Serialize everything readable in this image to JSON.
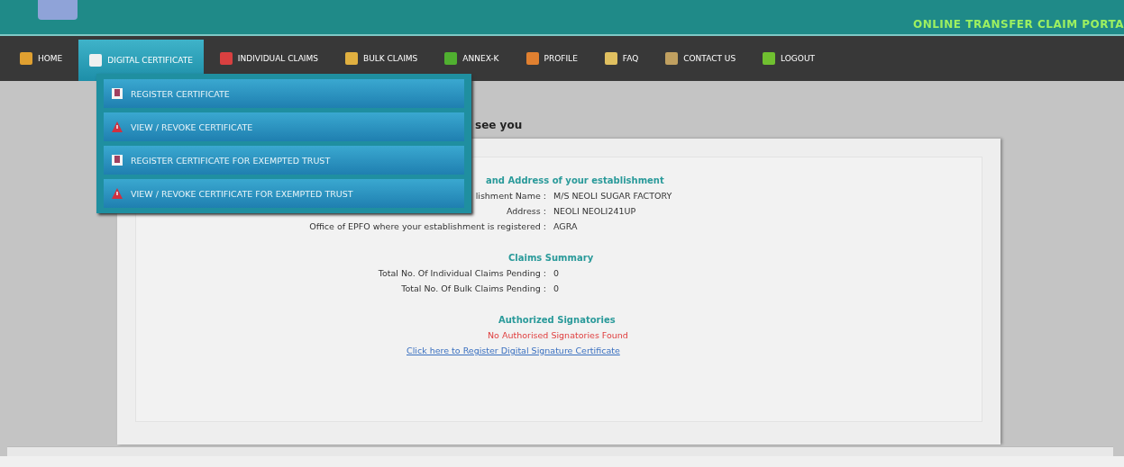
{
  "header": {
    "title": "ONLINE TRANSFER CLAIM PORTA"
  },
  "nav": [
    {
      "label": "HOME",
      "selected": false,
      "color": "#e0a030"
    },
    {
      "label": "DIGITAL CERTIFICATE",
      "selected": true,
      "color": "#f0f0f0"
    },
    {
      "label": "INDIVIDUAL CLAIMS",
      "selected": false,
      "color": "#d94040"
    },
    {
      "label": "BULK CLAIMS",
      "selected": false,
      "color": "#e0b040"
    },
    {
      "label": "ANNEX-K",
      "selected": false,
      "color": "#50b030"
    },
    {
      "label": "PROFILE",
      "selected": false,
      "color": "#e08030"
    },
    {
      "label": "FAQ",
      "selected": false,
      "color": "#e0c060"
    },
    {
      "label": "CONTACT US",
      "selected": false,
      "color": "#c0a060"
    },
    {
      "label": "LOGOUT",
      "selected": false,
      "color": "#70c030"
    }
  ],
  "dropdown": [
    {
      "label": "REGISTER CERTIFICATE",
      "kind": "register"
    },
    {
      "label": "VIEW / REVOKE CERTIFICATE",
      "kind": "revoke"
    },
    {
      "label": "REGISTER CERTIFICATE FOR EXEMPTED TRUST",
      "kind": "register"
    },
    {
      "label": "VIEW / REVOKE CERTIFICATE FOR EXEMPTED TRUST",
      "kind": "revoke"
    }
  ],
  "greeting": "see you",
  "establishment": {
    "heading": "and Address of your establishment",
    "rows": [
      {
        "label": "lishment Name :",
        "value": "M/S NEOLI SUGAR FACTORY"
      },
      {
        "label": "Address :",
        "value": "NEOLI NEOLI241UP"
      },
      {
        "label": "Office of EPFO where your establishment is registered :",
        "value": "AGRA"
      }
    ]
  },
  "claims": {
    "heading": "Claims Summary",
    "rows": [
      {
        "label": "Total No. Of Individual Claims Pending :",
        "value": "0"
      },
      {
        "label": "Total No. Of Bulk Claims Pending :",
        "value": "0"
      }
    ]
  },
  "signatories": {
    "heading": "Authorized Signatories",
    "message": "No Authorised Signatories Found",
    "link": "Click here to Register Digital Signature Certificate"
  }
}
